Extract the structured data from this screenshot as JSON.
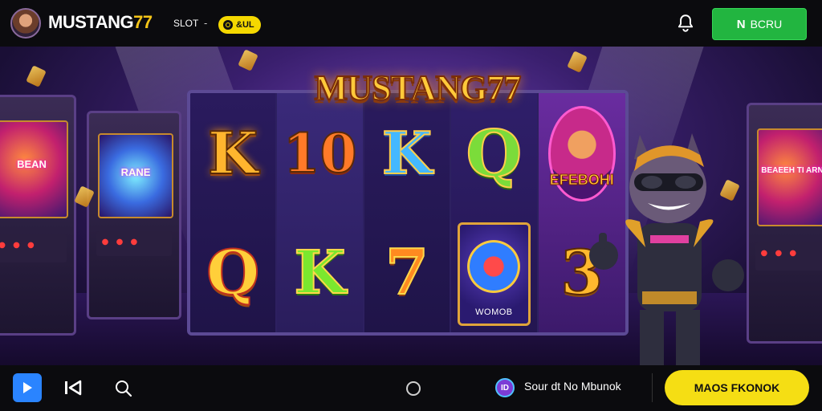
{
  "header": {
    "brand_text": "MUSTANG",
    "brand_number": "77",
    "slot_label": "SLOT",
    "separator": "-",
    "coin_pill_label": "&UL",
    "green_button_icon_text": "N",
    "green_button_label": "BCRU"
  },
  "game": {
    "logo_text": "MUSTANG77",
    "reels": [
      [
        "K",
        "Q"
      ],
      [
        "10",
        "K"
      ],
      [
        "K",
        "7"
      ],
      [
        "Q",
        "WILD"
      ],
      [
        "BONUS",
        "3"
      ]
    ],
    "bonus_label": "EFEBOHI",
    "wild_label": "WOMOB",
    "left_arcade_screen_text": "BEAN",
    "left2_arcade_screen_text": "RANE",
    "right_arcade_screen_text": "BEAEEH TI ARN"
  },
  "footer": {
    "id_icon_label": "ID",
    "status_text": "Sour dt No Mbunok",
    "yellow_button_label": "MAOS FKONOK"
  },
  "colors": {
    "brand_accent": "#f5c518",
    "green_button": "#22b540",
    "yellow_button": "#f5de14",
    "play_button": "#2a84ff",
    "topbar_bg": "#0b0b0e"
  },
  "icons": {
    "bell": "bell-icon",
    "play": "play-icon",
    "previous": "skip-back-icon",
    "search": "search-icon",
    "home": "circle-home-icon"
  }
}
